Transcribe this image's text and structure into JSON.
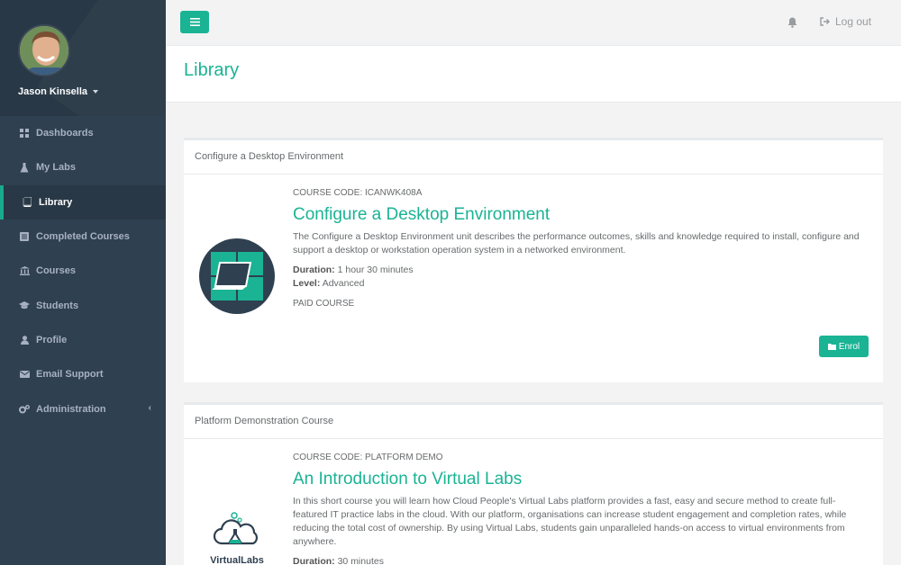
{
  "user": {
    "name": "Jason Kinsella"
  },
  "sidebar": {
    "items": [
      {
        "label": "Dashboards",
        "icon": "grid-icon"
      },
      {
        "label": "My Labs",
        "icon": "flask-icon"
      },
      {
        "label": "Library",
        "icon": "book-icon"
      },
      {
        "label": "Completed Courses",
        "icon": "list-icon"
      },
      {
        "label": "Courses",
        "icon": "bank-icon"
      },
      {
        "label": "Students",
        "icon": "graduation-cap-icon"
      },
      {
        "label": "Profile",
        "icon": "user-icon"
      },
      {
        "label": "Email Support",
        "icon": "envelope-icon"
      },
      {
        "label": "Administration",
        "icon": "gears-icon"
      }
    ],
    "active_index": 2
  },
  "topbar": {
    "logout_label": "Log out"
  },
  "page": {
    "title": "Library"
  },
  "courses": [
    {
      "card_title": "Configure a Desktop Environment",
      "code": "COURSE CODE: ICANWK408A",
      "name": "Configure a Desktop Environment",
      "description": "The Configure a Desktop Environment unit describes the performance outcomes, skills and knowledge required to install, configure and support a desktop or workstation operation system in a networked environment.",
      "duration_label": "Duration:",
      "duration": "1 hour 30 minutes",
      "level_label": "Level:",
      "level": "Advanced",
      "price": "PAID COURSE",
      "enroll_label": "Enrol"
    },
    {
      "card_title": "Platform Demonstration Course",
      "code": "COURSE CODE: PLATFORM DEMO",
      "name": "An Introduction to Virtual Labs",
      "description": "In this short course you will learn how Cloud People's Virtual Labs platform provides a fast, easy and secure method to create full-featured IT practice labs in the cloud. With our platform, organisations can increase student engagement and completion rates, while reducing the total cost of ownership. By using Virtual Labs, students gain unparalleled hands-on access to virtual environments from anywhere.",
      "duration_label": "Duration:",
      "duration": "30 minutes",
      "logo_text": "VirtualLabs"
    }
  ],
  "colors": {
    "accent": "#1ab394",
    "sidebar": "#2f4050",
    "sidebar_dark": "#293846"
  }
}
